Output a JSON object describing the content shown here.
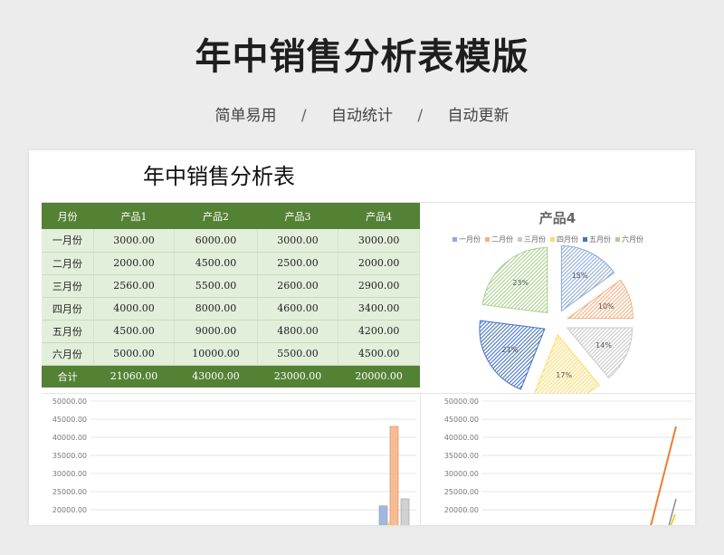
{
  "header": {
    "title": "年中销售分析表模版",
    "features": [
      "简单易用",
      "自动统计",
      "自动更新"
    ],
    "separator": "/"
  },
  "sheet": {
    "title": "年中销售分析表",
    "table": {
      "columns": [
        "月份",
        "产品1",
        "产品2",
        "产品3",
        "产品4"
      ],
      "rows": [
        [
          "一月份",
          "3000.00",
          "6000.00",
          "3000.00",
          "3000.00"
        ],
        [
          "二月份",
          "2000.00",
          "4500.00",
          "2500.00",
          "2000.00"
        ],
        [
          "三月份",
          "2560.00",
          "5500.00",
          "2600.00",
          "2900.00"
        ],
        [
          "四月份",
          "4000.00",
          "8000.00",
          "4600.00",
          "3400.00"
        ],
        [
          "五月份",
          "4500.00",
          "9000.00",
          "4800.00",
          "4200.00"
        ],
        [
          "六月份",
          "5000.00",
          "10000.00",
          "5500.00",
          "4500.00"
        ]
      ],
      "total": [
        "合计",
        "21060.00",
        "43000.00",
        "23000.00",
        "20000.00"
      ]
    }
  },
  "colors": {
    "header_green": "#548235",
    "row_green": "#e2efda",
    "series": [
      "#8faadc",
      "#f4b183",
      "#c9c9c9",
      "#ffd966",
      "#4472c4",
      "#a9d18e"
    ]
  },
  "chart_data": [
    {
      "type": "pie",
      "title": "产品4",
      "categories": [
        "一月份",
        "二月份",
        "三月份",
        "四月份",
        "五月份",
        "六月份"
      ],
      "values": [
        15,
        10,
        14,
        17,
        21,
        23
      ],
      "labels": [
        "15%",
        "10%",
        "14%",
        "17%",
        "21%",
        "23%"
      ],
      "legend": "top"
    },
    {
      "type": "bar",
      "yticks": [
        "50000.00",
        "45000.00",
        "40000.00",
        "35000.00",
        "30000.00",
        "25000.00",
        "20000.00"
      ],
      "ylim": [
        20000,
        50000
      ],
      "visible_values": [
        21060,
        43000,
        23000
      ]
    },
    {
      "type": "line",
      "yticks": [
        "50000.00",
        "45000.00",
        "40000.00",
        "35000.00",
        "30000.00",
        "25000.00",
        "20000.00"
      ],
      "ylim": [
        20000,
        50000
      ],
      "visible_values": [
        43000,
        23000
      ]
    }
  ]
}
